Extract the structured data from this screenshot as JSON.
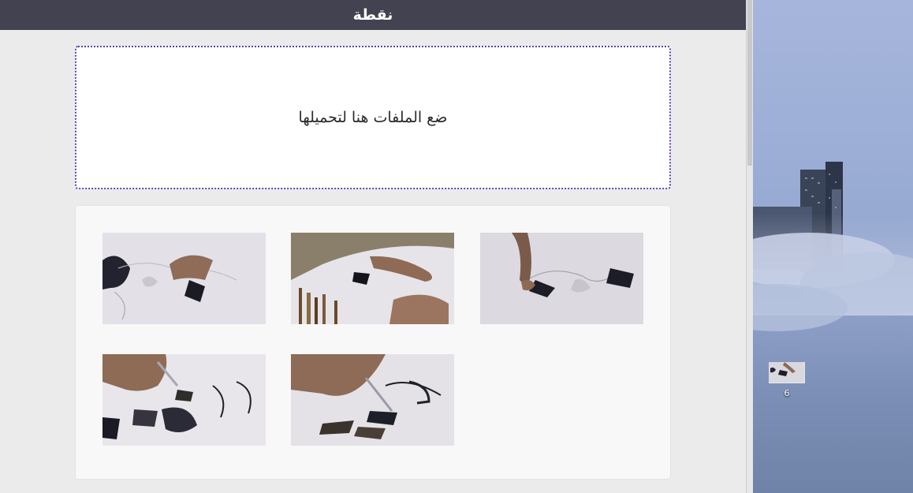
{
  "window": {
    "title": "نقطة"
  },
  "dropzone": {
    "text": "ضع الملفات هنا لتحميلها"
  },
  "gallery": {
    "images": [
      {
        "icon": "calligraphy-photo"
      },
      {
        "icon": "calligraphy-photo"
      },
      {
        "icon": "calligraphy-photo"
      },
      {
        "icon": "calligraphy-photo"
      },
      {
        "icon": "calligraphy-photo"
      }
    ]
  },
  "desktop": {
    "file_icon": {
      "label": "6",
      "icon": "image-file-icon"
    }
  },
  "colors": {
    "title_bar": "#434250",
    "dropzone_border": "#5e3fb0",
    "window_bg": "#ebebeb"
  }
}
